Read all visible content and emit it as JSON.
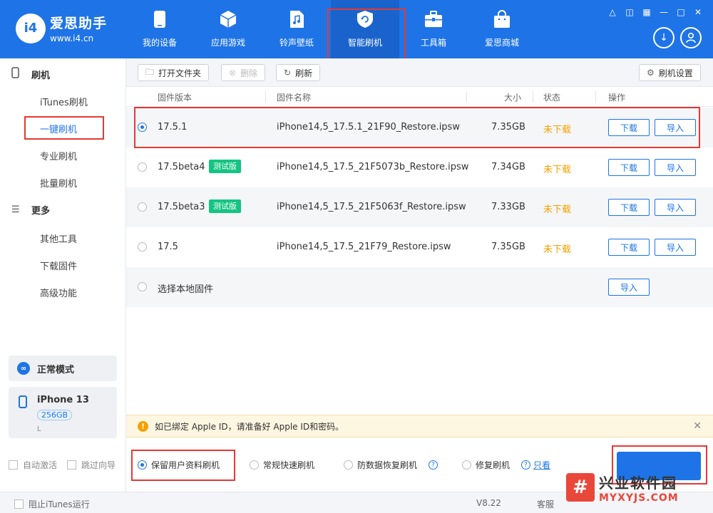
{
  "app": {
    "logo_badge": "i4",
    "logo_name": "爱思助手",
    "logo_url": "www.i4.cn"
  },
  "nav": {
    "items": [
      {
        "label": "我的设备",
        "icon": "phone-icon"
      },
      {
        "label": "应用游戏",
        "icon": "cube-icon"
      },
      {
        "label": "铃声壁纸",
        "icon": "music-file-icon"
      },
      {
        "label": "智能刷机",
        "icon": "shield-refresh-icon",
        "active": true
      },
      {
        "label": "工具箱",
        "icon": "toolbox-icon"
      },
      {
        "label": "爱思商城",
        "icon": "shopping-bag-icon"
      }
    ],
    "window_controls": [
      "shirt-icon",
      "tablet-icon",
      "grid-icon",
      "minimize-icon",
      "maximize-icon",
      "close-icon"
    ],
    "download_icon": "download-icon",
    "user_icon": "user-icon"
  },
  "sidebar": {
    "section_flash": "刷机",
    "flash_items": [
      "iTunes刷机",
      "一键刷机",
      "专业刷机",
      "批量刷机"
    ],
    "section_more": "更多",
    "more_items": [
      "其他工具",
      "下载固件",
      "高级功能"
    ],
    "mode_label": "正常模式",
    "device": {
      "name": "iPhone 13",
      "storage": "256GB",
      "extra": "L"
    },
    "auto_activate": "自动激活",
    "skip_guide": "跳过向导"
  },
  "toolbar": {
    "open_folder": "打开文件夹",
    "delete": "删除",
    "refresh": "刷新",
    "flash_settings": "刷机设置"
  },
  "table": {
    "headers": {
      "version": "固件版本",
      "name": "固件名称",
      "size": "大小",
      "status": "状态",
      "action": "操作"
    },
    "rows": [
      {
        "version": "17.5.1",
        "badge": "",
        "name": "iPhone14,5_17.5.1_21F90_Restore.ipsw",
        "size": "7.35GB",
        "status": "未下载",
        "download": "下载",
        "import": "导入",
        "selected": true
      },
      {
        "version": "17.5beta4",
        "badge": "测试版",
        "name": "iPhone14,5_17.5_21F5073b_Restore.ipsw",
        "size": "7.34GB",
        "status": "未下载",
        "download": "下载",
        "import": "导入",
        "selected": false
      },
      {
        "version": "17.5beta3",
        "badge": "测试版",
        "name": "iPhone14,5_17.5_21F5063f_Restore.ipsw",
        "size": "7.33GB",
        "status": "未下载",
        "download": "下载",
        "import": "导入",
        "selected": false
      },
      {
        "version": "17.5",
        "badge": "",
        "name": "iPhone14,5_17.5_21F79_Restore.ipsw",
        "size": "7.35GB",
        "status": "未下载",
        "download": "下载",
        "import": "导入",
        "selected": false
      }
    ],
    "local": {
      "label": "选择本地固件",
      "import": "导入"
    }
  },
  "notice": {
    "text": "如已绑定 Apple ID，请准备好 Apple ID和密码。"
  },
  "options": {
    "keep_data": "保留用户资料刷机",
    "fast": "常规快速刷机",
    "anti_recovery": "防数据恢复刷机",
    "repair": "修复刷机",
    "link": "只看"
  },
  "footer": {
    "block_itunes": "阻止iTunes运行",
    "version": "V8.22",
    "service": "客服"
  },
  "watermark": {
    "glyph": "#",
    "line1": "兴业软件园",
    "line2": "MYXYJS.COM"
  },
  "colors": {
    "brand": "#1e74e6",
    "warning": "#f5a000",
    "beta_badge": "#14c482",
    "annotation": "#e53935"
  }
}
